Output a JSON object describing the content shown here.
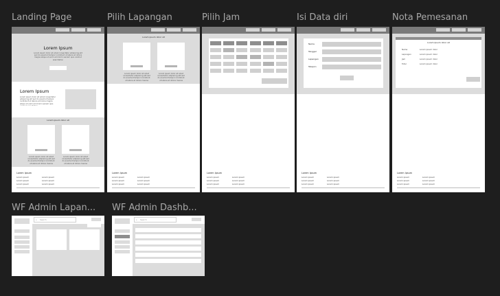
{
  "canvas": {
    "background": "#1e1e1e"
  },
  "frames": {
    "landing": {
      "title": "Landing Page",
      "hero_title": "Lorem Ipsum",
      "section_title": "Lorem Ipsum",
      "cards_title": "Lorem ipsum dolor sit",
      "footer_title": "Lorem Ipsum",
      "footer_link": "Lorem ipsum"
    },
    "lapangan": {
      "title": "Pilih Lapangan",
      "heading": "Lorem ipsum dolor sit",
      "footer_title": "Lorem Ipsum",
      "footer_link": "Lorem ipsum"
    },
    "jam": {
      "title": "Pilih Jam",
      "footer_title": "Lorem Ipsum",
      "footer_link": "Lorem ipsum"
    },
    "data_diri": {
      "title": "Isi Data diri",
      "labels": [
        "Nama",
        "Tanggal",
        "Lapangan",
        "Telepon"
      ],
      "footer_title": "Lorem Ipsum",
      "footer_link": "Lorem ipsum"
    },
    "nota": {
      "title": "Nota Pemesanan",
      "heading": "Lorem Ipsum dolor sit",
      "rows": [
        [
          "Nama",
          "Lorem ipsum dolor"
        ],
        [
          "Lapangan",
          "Lorem ipsum dolor"
        ],
        [
          "Jam",
          "Lorem ipsum dolor"
        ],
        [
          "Total",
          "Lorem ipsum dolor"
        ]
      ],
      "footer_title": "Lorem Ipsum",
      "footer_link": "Lorem ipsum"
    },
    "admin_lapangan": {
      "title": "WF Admin Lapan...",
      "search_placeholder": "Search"
    },
    "admin_dashboard": {
      "title": "WF Admin Dashb...",
      "search_placeholder": "Search"
    }
  },
  "lorem_paragraph": "Lorem ipsum dolor sit amet consectetur adipiscing elit sed do eiusmod tempor incididunt ut labore et dolore magna aliqua ut enim ad minim veniam quis nostrud exercitation"
}
